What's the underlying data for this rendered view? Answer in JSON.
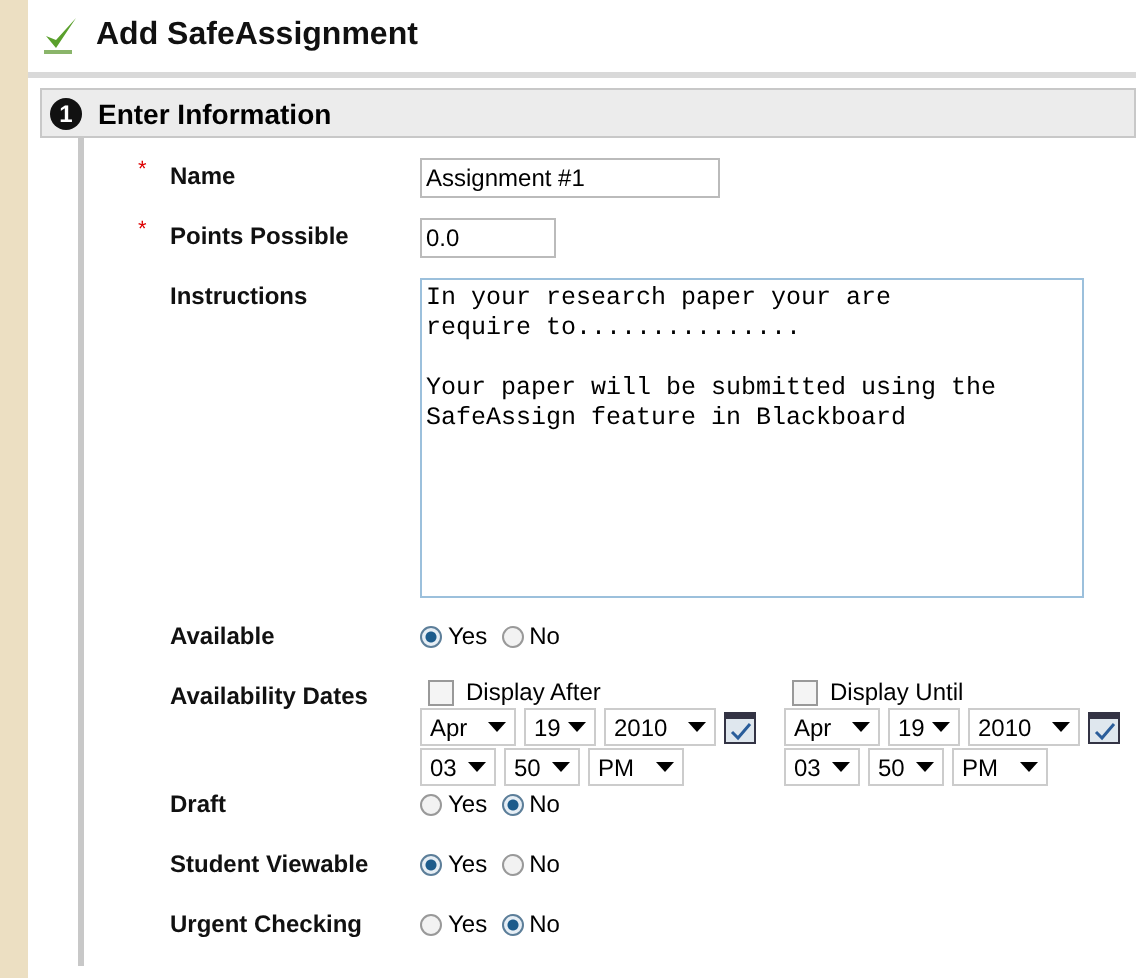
{
  "page": {
    "title": "Add SafeAssignment"
  },
  "section": {
    "number": "1",
    "title": "Enter Information"
  },
  "fields": [
    {
      "kind": "text",
      "label": "Name",
      "marker": "*",
      "value": "Assignment #1"
    },
    {
      "kind": "text",
      "label": "Points Possible",
      "marker": "*",
      "value": "0.0"
    },
    {
      "kind": "textarea",
      "label": "Instructions",
      "value": "In your research paper your are\nrequire to...............\n\nYour paper will be submitted using the\nSafeAssign feature in Blackboard"
    },
    {
      "kind": "radio",
      "label": "Available",
      "options": [
        {
          "label": "Yes",
          "selected": true
        },
        {
          "label": "No",
          "selected": false
        }
      ]
    },
    {
      "kind": "dates",
      "label": "Availability Dates",
      "groups": [
        {
          "label": "Display After",
          "checked": false,
          "date": [
            "Apr",
            "19",
            "2010"
          ],
          "time": [
            "03",
            "50",
            "PM"
          ]
        },
        {
          "label": "Display Until",
          "checked": false,
          "date": [
            "Apr",
            "19",
            "2010"
          ],
          "time": [
            "03",
            "50",
            "PM"
          ]
        }
      ]
    },
    {
      "kind": "radio",
      "label": "Draft",
      "options": [
        {
          "label": "Yes",
          "selected": false
        },
        {
          "label": "No",
          "selected": true
        }
      ]
    },
    {
      "kind": "radio",
      "label": "Student Viewable",
      "options": [
        {
          "label": "Yes",
          "selected": true
        },
        {
          "label": "No",
          "selected": false
        }
      ]
    },
    {
      "kind": "radio",
      "label": "Urgent Checking",
      "options": [
        {
          "label": "Yes",
          "selected": false
        },
        {
          "label": "No",
          "selected": true
        }
      ]
    }
  ]
}
